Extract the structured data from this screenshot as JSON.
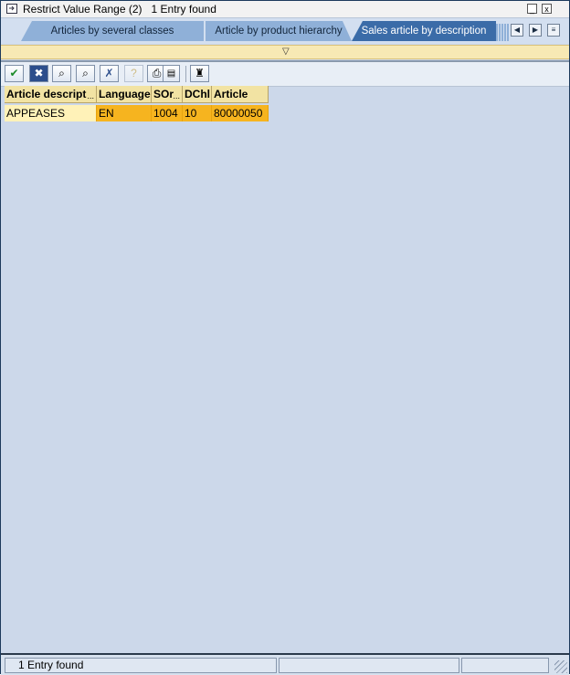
{
  "window": {
    "title": "Restrict Value Range (2)",
    "entries_found": "1 Entry found",
    "minimize_glyph": "_",
    "close_glyph": "x"
  },
  "tabs": {
    "items": [
      {
        "label": "Articles by several classes"
      },
      {
        "label": "Article by product hierarchy"
      },
      {
        "label": "Sales article by description"
      }
    ],
    "active_index": 2,
    "prev_glyph": "◀",
    "next_glyph": "▶",
    "list_glyph": "≡"
  },
  "collapse": {
    "glyph": "▽"
  },
  "toolbar": {
    "buttons": [
      {
        "icon": "check-icon",
        "glyph": "✔"
      },
      {
        "icon": "cancel-icon",
        "glyph": "✖"
      },
      {
        "icon": "find-icon",
        "glyph": "⌕"
      },
      {
        "icon": "find-next-icon",
        "glyph": "⌕"
      },
      {
        "icon": "delete-restriction-icon",
        "glyph": "✗"
      },
      {
        "icon": "help-icon",
        "glyph": "?"
      },
      {
        "icon": "print-icon",
        "glyph": "⎙"
      },
      {
        "icon": "personal-list-icon",
        "glyph": "♜"
      }
    ]
  },
  "table": {
    "columns": [
      {
        "label": "Article descript",
        "truncated": true
      },
      {
        "label": "Language",
        "truncated": false
      },
      {
        "label": "SOr",
        "truncated": true
      },
      {
        "label": "DChl",
        "truncated": false
      },
      {
        "label": "Article",
        "truncated": false
      }
    ],
    "rows": [
      [
        "APPEASES",
        "EN",
        "1004",
        "10",
        "80000050"
      ]
    ],
    "more_glyph": "..."
  },
  "status": {
    "text": "1 Entry found"
  },
  "colors": {
    "header_bg": "#f2e3a3",
    "selected_row": "#f6b41f",
    "active_tab": "#3b6ca8",
    "background": "#ccd8ea"
  }
}
